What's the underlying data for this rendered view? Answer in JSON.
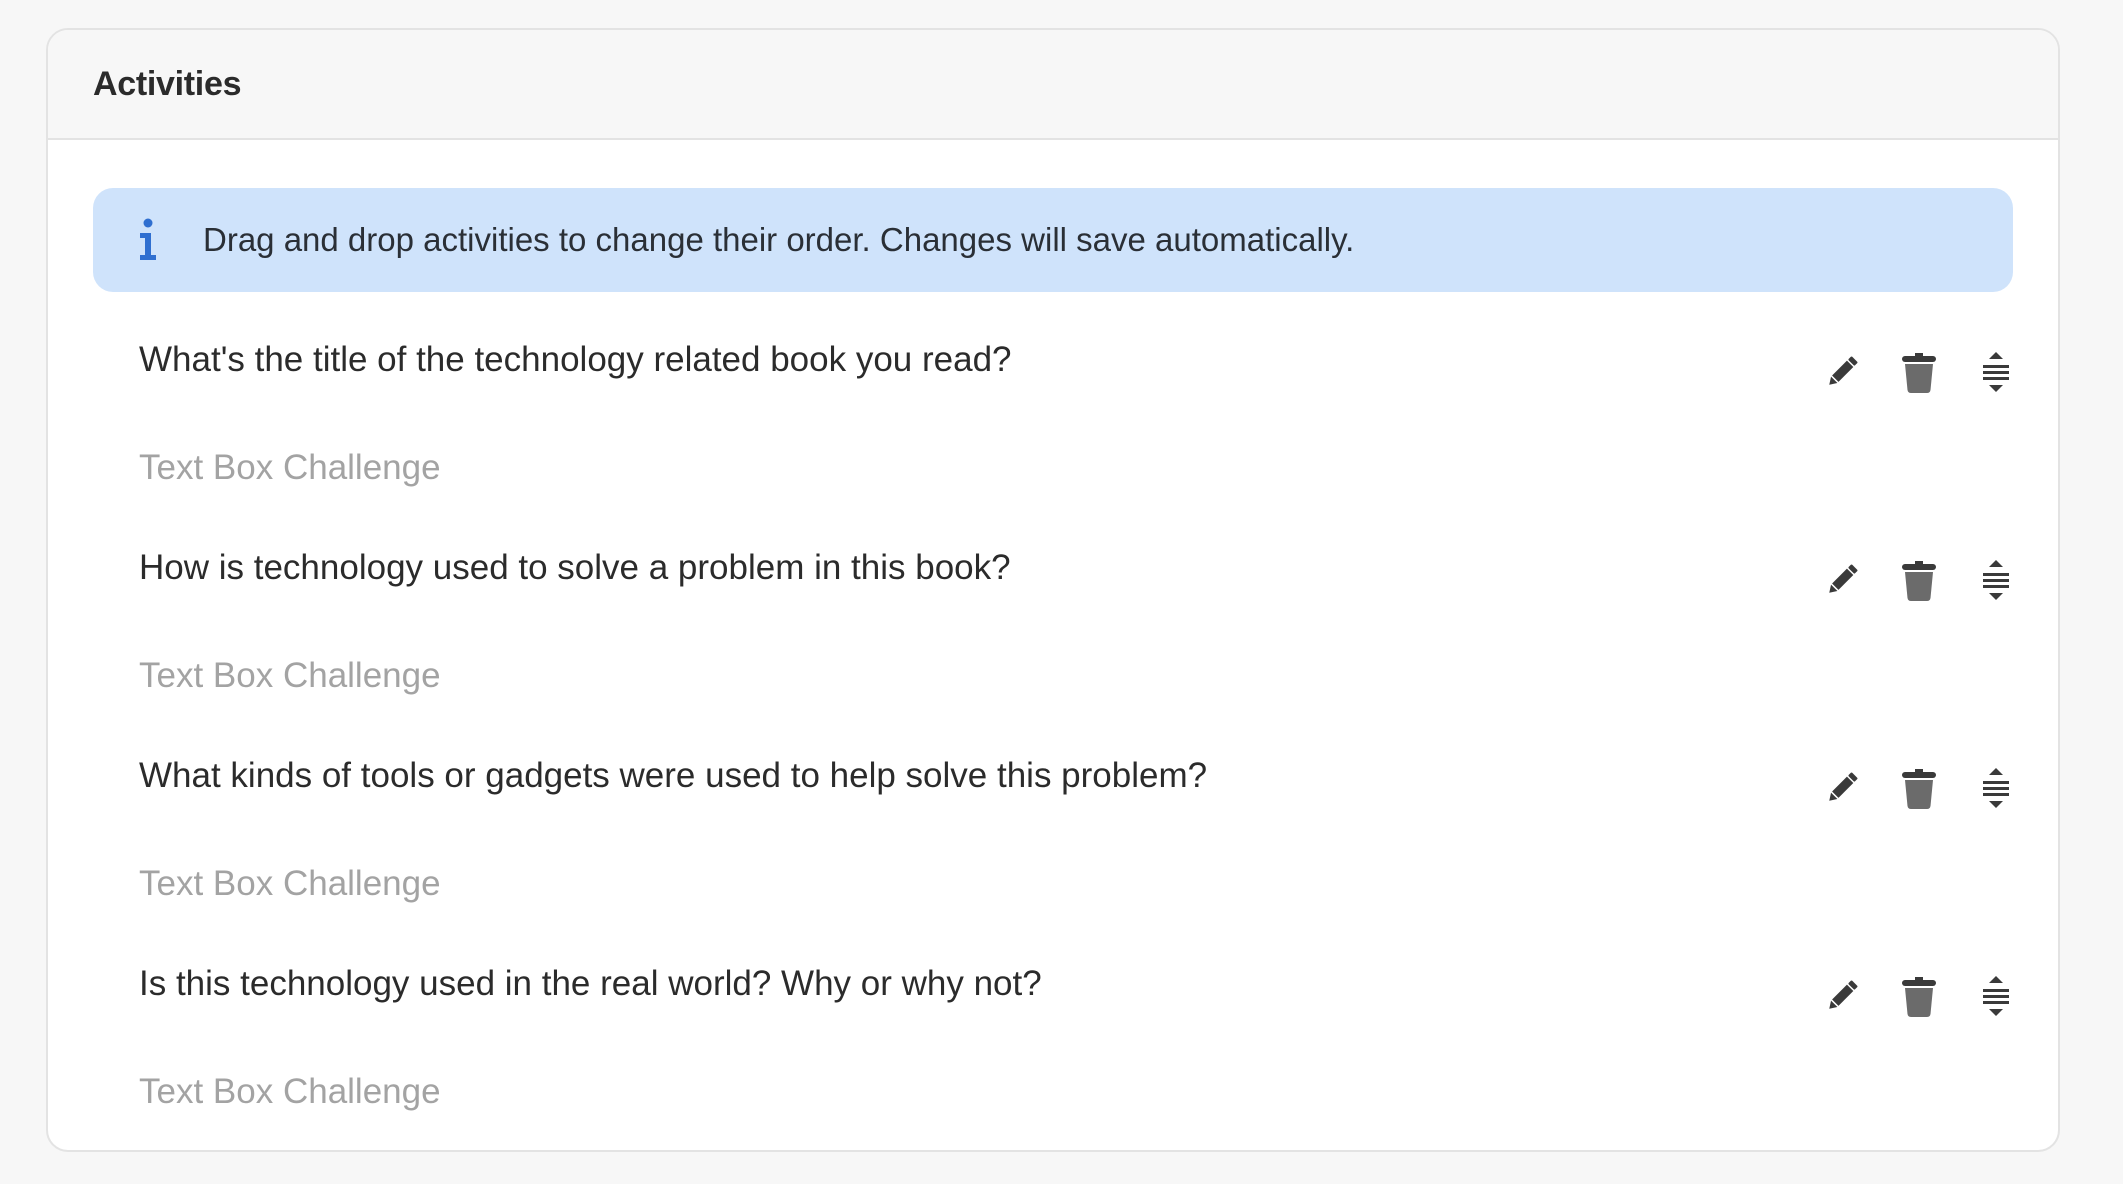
{
  "panel": {
    "title": "Activities"
  },
  "info": {
    "icon": "info-icon",
    "message": "Drag and drop activities to change their order. Changes will save automatically."
  },
  "activities": [
    {
      "title": "What's the title of the technology related book you read?",
      "type": "Text Box Challenge"
    },
    {
      "title": "How is technology used to solve a problem in this book?",
      "type": "Text Box Challenge"
    },
    {
      "title": "What kinds of tools or gadgets were used to help solve this problem?",
      "type": "Text Box Challenge"
    },
    {
      "title": "Is this technology used in the real world? Why or why not?",
      "type": "Text Box Challenge"
    }
  ],
  "actions": {
    "edit_icon": "pencil-icon",
    "delete_icon": "trash-icon",
    "reorder_icon": "drag-handle-icon"
  },
  "colors": {
    "banner_bg": "#cfe3fb",
    "info_icon": "#2f6fd0",
    "title_text": "#2b2b2b",
    "subtitle_text": "#a3a3a3",
    "icon_dark": "#3a3a3a",
    "icon_trash": "#6b6b6b"
  }
}
